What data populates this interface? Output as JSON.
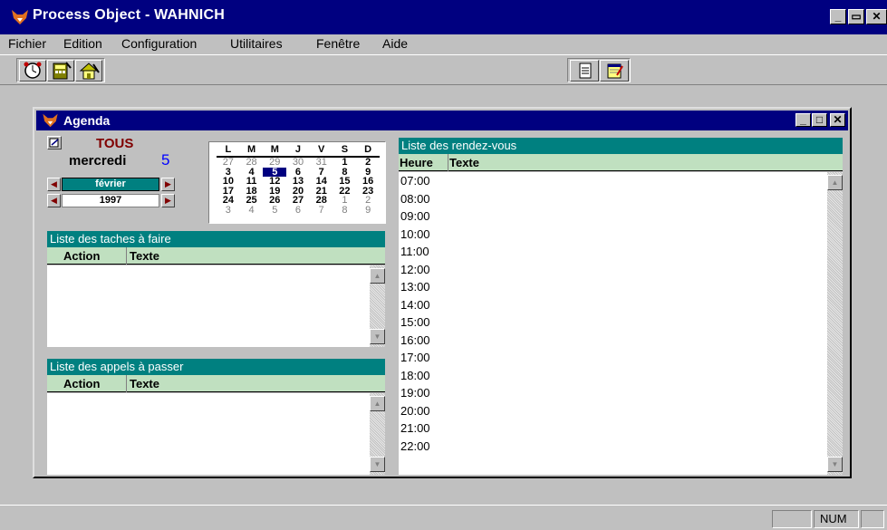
{
  "window": {
    "title": "Process Object - WAHNICH"
  },
  "menu": {
    "items": [
      {
        "label": "Fichier"
      },
      {
        "label": "Edition"
      },
      {
        "label": "Configuration"
      },
      {
        "label": "Utilitaires"
      },
      {
        "label": "Fenêtre"
      },
      {
        "label": "Aide"
      }
    ]
  },
  "toolbar": {
    "left_icons": [
      "clock-icon",
      "calculator-icon",
      "house-edit-icon"
    ],
    "right_icons": [
      "document-icon",
      "notepad-icon"
    ]
  },
  "agenda": {
    "title": "Agenda",
    "filter": "TOUS",
    "weekday": "mercredi",
    "day_number": "5",
    "month": "février",
    "year": "1997",
    "calendar": {
      "headers": [
        "L",
        "M",
        "M",
        "J",
        "V",
        "S",
        "D"
      ],
      "weeks": [
        [
          "27",
          "28",
          "29",
          "30",
          "31",
          "1",
          "2"
        ],
        [
          "3",
          "4",
          "5",
          "6",
          "7",
          "8",
          "9"
        ],
        [
          "10",
          "11",
          "12",
          "13",
          "14",
          "15",
          "16"
        ],
        [
          "17",
          "18",
          "19",
          "20",
          "21",
          "22",
          "23"
        ],
        [
          "24",
          "25",
          "26",
          "27",
          "28",
          "1",
          "2"
        ],
        [
          "3",
          "4",
          "5",
          "6",
          "7",
          "8",
          "9"
        ]
      ]
    },
    "tasks": {
      "title": "Liste des taches à faire",
      "col_action": "Action",
      "col_text": "Texte"
    },
    "calls": {
      "title": "Liste des appels à passer",
      "col_action": "Action",
      "col_text": "Texte"
    },
    "appointments": {
      "title": "Liste des rendez-vous",
      "col_hour": "Heure",
      "col_text": "Texte",
      "hours": [
        "07:00",
        "08:00",
        "09:00",
        "10:00",
        "11:00",
        "12:00",
        "13:00",
        "14:00",
        "15:00",
        "16:00",
        "17:00",
        "18:00",
        "19:00",
        "20:00",
        "21:00",
        "22:00"
      ]
    }
  },
  "status": {
    "num": "NUM"
  }
}
